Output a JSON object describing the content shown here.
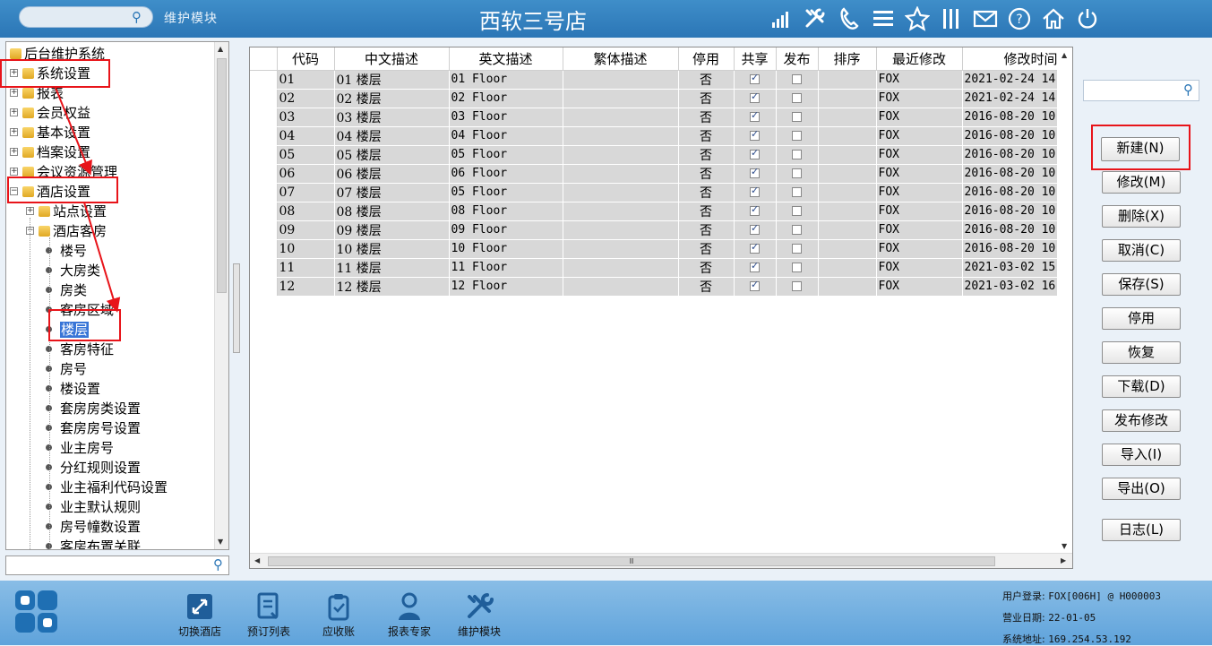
{
  "header": {
    "search_placeholder": "",
    "module_label": "维护模块",
    "store_title": "西软三号店",
    "icons": [
      "signal-icon",
      "tools-icon",
      "phone-icon",
      "menu-icon",
      "star-icon",
      "columns-icon",
      "mail-icon",
      "help-icon",
      "home-icon",
      "power-icon"
    ]
  },
  "tree": {
    "root": "后台维护系统",
    "nodes": [
      {
        "label": "系统设置",
        "type": "folder",
        "level": 1
      },
      {
        "label": "报表",
        "type": "folder",
        "level": 1
      },
      {
        "label": "会员权益",
        "type": "folder",
        "level": 1
      },
      {
        "label": "基本设置",
        "type": "folder",
        "level": 1
      },
      {
        "label": "档案设置",
        "type": "folder",
        "level": 1
      },
      {
        "label": "会议资源管理",
        "type": "folder",
        "level": 1
      },
      {
        "label": "酒店设置",
        "type": "folder",
        "level": 1,
        "expanded": true
      },
      {
        "label": "站点设置",
        "type": "folder",
        "level": 2
      },
      {
        "label": "酒店客房",
        "type": "folder",
        "level": 2,
        "expanded": true
      },
      {
        "label": "楼号",
        "type": "leaf",
        "level": 3
      },
      {
        "label": "大房类",
        "type": "leaf",
        "level": 3
      },
      {
        "label": "房类",
        "type": "leaf",
        "level": 3
      },
      {
        "label": "客房区域",
        "type": "leaf",
        "level": 3
      },
      {
        "label": "楼层",
        "type": "leaf",
        "level": 3,
        "selected": true
      },
      {
        "label": "客房特征",
        "type": "leaf",
        "level": 3
      },
      {
        "label": "房号",
        "type": "leaf",
        "level": 3
      },
      {
        "label": "楼设置",
        "type": "leaf",
        "level": 3
      },
      {
        "label": "套房房类设置",
        "type": "leaf",
        "level": 3
      },
      {
        "label": "套房房号设置",
        "type": "leaf",
        "level": 3
      },
      {
        "label": "业主房号",
        "type": "leaf",
        "level": 3
      },
      {
        "label": "分红规则设置",
        "type": "leaf",
        "level": 3
      },
      {
        "label": "业主福利代码设置",
        "type": "leaf",
        "level": 3
      },
      {
        "label": "业主默认规则",
        "type": "leaf",
        "level": 3
      },
      {
        "label": "房号幢数设置",
        "type": "leaf",
        "level": 3
      },
      {
        "label": "客房布置关联",
        "type": "leaf",
        "level": 3
      }
    ],
    "search_placeholder": ""
  },
  "grid": {
    "columns": [
      "代码",
      "中文描述",
      "英文描述",
      "繁体描述",
      "停用",
      "共享",
      "发布",
      "排序",
      "最近修改",
      "修改时间"
    ],
    "rows": [
      {
        "code": "01",
        "cn": "01 楼层",
        "en": "01 Floor",
        "tw": "",
        "disabled": "否",
        "shared": true,
        "published": false,
        "sort": "",
        "modifier": "FOX",
        "modified": "2021-02-24 14"
      },
      {
        "code": "02",
        "cn": "02 楼层",
        "en": "02 Floor",
        "tw": "",
        "disabled": "否",
        "shared": true,
        "published": false,
        "sort": "",
        "modifier": "FOX",
        "modified": "2021-02-24 14"
      },
      {
        "code": "03",
        "cn": "03 楼层",
        "en": "03 Floor",
        "tw": "",
        "disabled": "否",
        "shared": true,
        "published": false,
        "sort": "",
        "modifier": "FOX",
        "modified": "2016-08-20 10"
      },
      {
        "code": "04",
        "cn": "04 楼层",
        "en": "04 Floor",
        "tw": "",
        "disabled": "否",
        "shared": true,
        "published": false,
        "sort": "",
        "modifier": "FOX",
        "modified": "2016-08-20 10"
      },
      {
        "code": "05",
        "cn": "05 楼层",
        "en": "05 Floor",
        "tw": "",
        "disabled": "否",
        "shared": true,
        "published": false,
        "sort": "",
        "modifier": "FOX",
        "modified": "2016-08-20 10"
      },
      {
        "code": "06",
        "cn": "06 楼层",
        "en": "06 Floor",
        "tw": "",
        "disabled": "否",
        "shared": true,
        "published": false,
        "sort": "",
        "modifier": "FOX",
        "modified": "2016-08-20 10"
      },
      {
        "code": "07",
        "cn": "07 楼层",
        "en": "05 Floor",
        "tw": "",
        "disabled": "否",
        "shared": true,
        "published": false,
        "sort": "",
        "modifier": "FOX",
        "modified": "2016-08-20 10"
      },
      {
        "code": "08",
        "cn": "08 楼层",
        "en": "08 Floor",
        "tw": "",
        "disabled": "否",
        "shared": true,
        "published": false,
        "sort": "",
        "modifier": "FOX",
        "modified": "2016-08-20 10"
      },
      {
        "code": "09",
        "cn": "09 楼层",
        "en": "09 Floor",
        "tw": "",
        "disabled": "否",
        "shared": true,
        "published": false,
        "sort": "",
        "modifier": "FOX",
        "modified": "2016-08-20 10"
      },
      {
        "code": "10",
        "cn": "10 楼层",
        "en": "10 Floor",
        "tw": "",
        "disabled": "否",
        "shared": true,
        "published": false,
        "sort": "",
        "modifier": "FOX",
        "modified": "2016-08-20 10"
      },
      {
        "code": "11",
        "cn": "11 楼层",
        "en": "11 Floor",
        "tw": "",
        "disabled": "否",
        "shared": true,
        "published": false,
        "sort": "",
        "modifier": "FOX",
        "modified": "2021-03-02 15"
      },
      {
        "code": "12",
        "cn": "12 楼层",
        "en": "12 Floor",
        "tw": "",
        "disabled": "否",
        "shared": true,
        "published": false,
        "sort": "",
        "modifier": "FOX",
        "modified": "2021-03-02 16"
      }
    ],
    "hscroll_grip": "Ⅲ"
  },
  "actions": {
    "search_placeholder": "",
    "buttons": [
      "新建(N)",
      "修改(M)",
      "删除(X)",
      "取消(C)",
      "保存(S)",
      "停用",
      "恢复",
      "下载(D)",
      "发布修改",
      "导入(I)",
      "导出(O)",
      "日志(L)"
    ]
  },
  "footer": {
    "tools": [
      {
        "label": "切换酒店",
        "icon": "switch-hotel-icon"
      },
      {
        "label": "预订列表",
        "icon": "booking-list-icon"
      },
      {
        "label": "应收账",
        "icon": "receivable-icon"
      },
      {
        "label": "报表专家",
        "icon": "report-expert-icon"
      },
      {
        "label": "维护模块",
        "icon": "maintenance-icon"
      }
    ],
    "info": {
      "login_label": "用户登录:",
      "login_value": "FOX[006H] @ H000003",
      "bizdate_label": "营业日期:",
      "bizdate_value": "22-01-05",
      "addr_label": "系统地址:",
      "addr_value": "169.254.53.192"
    }
  },
  "colors": {
    "header": "#2b76b6",
    "highlight": "#e8141a",
    "selection": "#3875d7",
    "row_bg": "#d8d8d8"
  }
}
